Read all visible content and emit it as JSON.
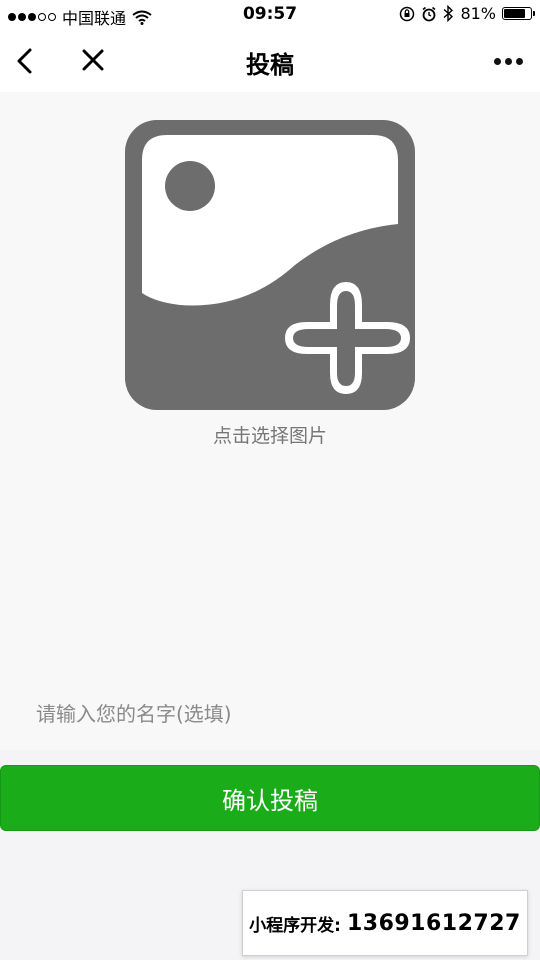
{
  "status_bar": {
    "carrier": "中国联通",
    "time": "09:57",
    "battery_percent": "81%",
    "battery_level": 0.81
  },
  "nav": {
    "title": "投稿",
    "icons": [
      "back-chevron-icon",
      "close-icon",
      "more-icon"
    ]
  },
  "picker": {
    "label": "点击选择图片",
    "icon": "add-image-icon",
    "icon_color": "#6d6d6d"
  },
  "form": {
    "name_value": "",
    "name_placeholder": "请输入您的名字(选填)",
    "submit_label": "确认投稿"
  },
  "promo": {
    "label": "小程序开发:",
    "phone": "13691612727"
  },
  "colors": {
    "primary_green": "#1aad19",
    "background": "#f8f8f8"
  }
}
